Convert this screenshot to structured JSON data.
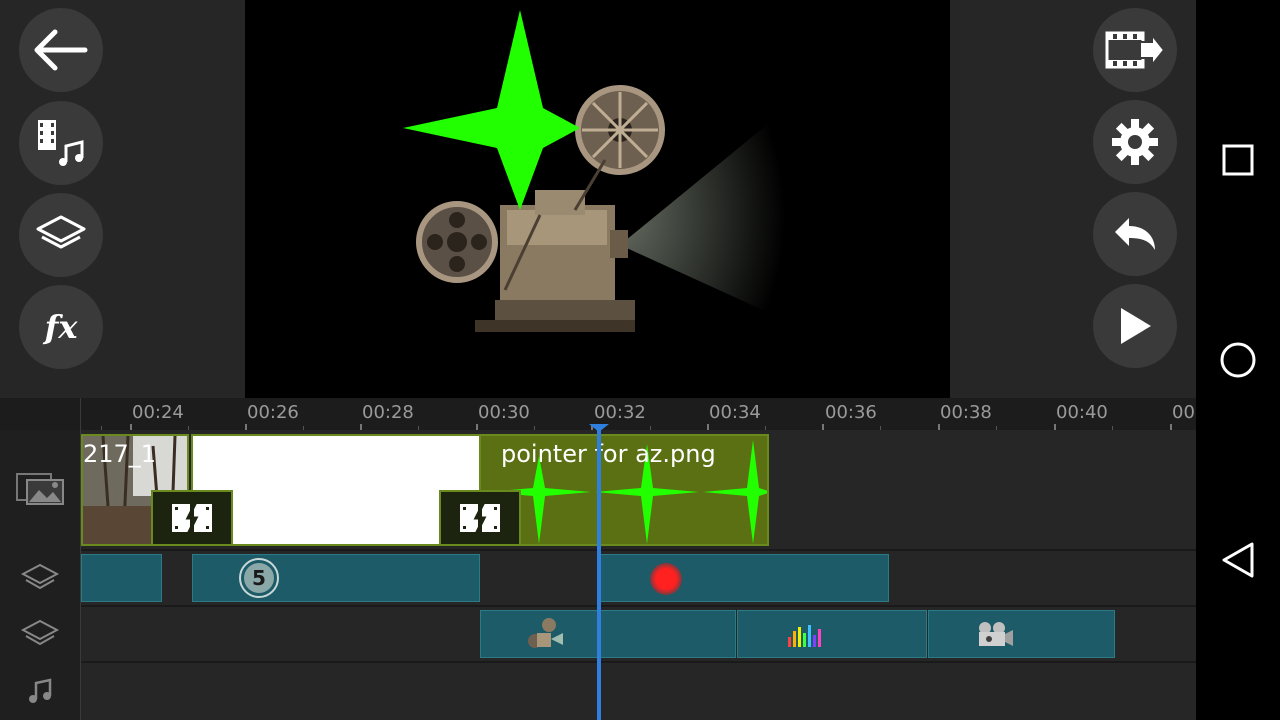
{
  "left_toolbar": {
    "back": "back-arrow-icon",
    "media": "media-music-icon",
    "layers": "layers-icon",
    "effects_label": "fx"
  },
  "right_toolbar": {
    "export": "export-icon",
    "settings": "gear-icon",
    "undo": "undo-icon",
    "play": "play-icon"
  },
  "timeline": {
    "ruler": [
      "00:24",
      "00:26",
      "00:28",
      "00:30",
      "00:32",
      "00:34",
      "00:36",
      "00:38",
      "00:40",
      "00"
    ],
    "video_track": {
      "clip1_label": "217_1",
      "clip_image_label": "pointer for az.png"
    },
    "layer_track_1": {
      "badge_number": "5"
    }
  },
  "navbar": [
    "recents-square-icon",
    "home-circle-icon",
    "back-triangle-icon"
  ],
  "colors": {
    "teal_clip": "#1c5b67",
    "green_clip": "#5a7012",
    "playhead": "#2f7fe0",
    "star_green": "#22ff00"
  }
}
